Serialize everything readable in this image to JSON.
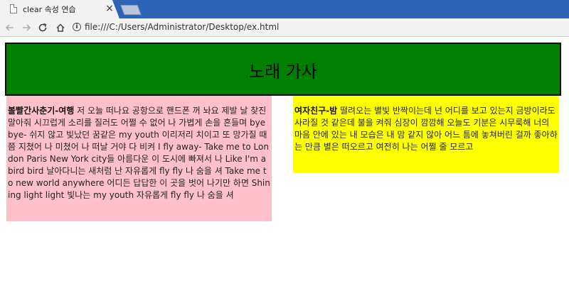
{
  "browser": {
    "tab_title": "clear 속성 연습",
    "tab_close_glyph": "×",
    "url": "file:///C:/Users/Administrator/Desktop/ex.html",
    "icons": {
      "back": "arrow-left-icon",
      "forward": "arrow-right-icon",
      "reload": "reload-icon",
      "home": "home-icon",
      "page_info": "info-icon",
      "tab_page": "document-icon"
    }
  },
  "page": {
    "title": "노래 가사",
    "colors": {
      "header_bg": "#008000",
      "left_box_bg": "#ffc0cb",
      "right_box_bg": "#ffff00"
    },
    "left": {
      "heading": "볼빨간사춘기-여행",
      "lyrics": " 저 오늘 떠나요 공항으로 핸드폰 꺼 놔요 제발 날 찾진 말아줘 시끄럽게 소리를 질러도 어쩔 수 없어 나 가볍게 손을 흔들며 bye bye- 쉬지 않고 빛났던 꿈같은 my youth 이리저리 치이고 또 망가질 때쯤 지쳤어 나 미쳤어 나 떠날 거야 다 비켜 I fly away- Take me to London Paris New York city들 아름다운 이 도시에 빠져서 나 Like I'm a bird bird 날아다니는 새처럼 난 자유롭게 fly fly 나 숨을 셔 Take me to new world anywhere 어디든 답답한 이 곳을 벗어 나기만 하면 Shining light light 빛나는 my youth 자유롭게 fly fly 나 숨을 셔"
    },
    "right": {
      "heading": "여자친구-밤",
      "lyrics": " 떨려오는 별빛 반짝이는데 넌 어디를 보고 있는지 금방이라도 사라질 것 같은데 불을 켜줘 심장이 깜깜해 오늘도 기분은 시무룩해 너의 마음 안에 있는 내 모습은 내 맘 같지 않아 어느 틈에 놓쳐버린 걸까 좋아하는 만큼 별은 떠오르고 여전히 나는 어쩔 줄 모르고"
    }
  }
}
